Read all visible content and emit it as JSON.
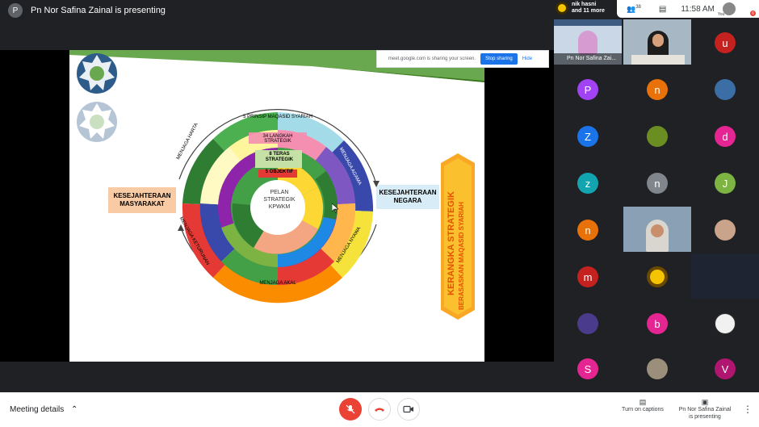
{
  "header": {
    "presenter_initial": "P",
    "presenting_title": "Pn Nor Safina Zainal is presenting"
  },
  "share_bar": {
    "message": "meet.google.com is sharing your screen.",
    "stop_label": "Stop sharing",
    "hide_label": "Hide"
  },
  "slide": {
    "left_box": "KESEJAHTERAAN MASYARAKAT",
    "right_box": "KESEJAHTERAAN NEGARA",
    "ribbon_main": "KERANGKA STRATEGIK",
    "ribbon_sub": "BERASASKAN MAQASID SYARIAH",
    "center_line1": "PELAN",
    "center_line2": "STRATEGIK",
    "center_line3": "KPWKM",
    "ring_outer": "5 PRINSIP MAQASID SYARIAH",
    "ring_langkah": "34 LANGKAH STRATEGIK",
    "ring_teras": "8 TERAS STRATEGIK",
    "ring_objektif": "5 OBJEKTIF",
    "seg_harta": "MENJAGA HARTA",
    "seg_agama": "MENJAGA AGAMA",
    "seg_nyawa": "MENJAGA NYAWA",
    "seg_akal": "MENJAGA AKAL",
    "seg_keturunan": "MENJAGA KETURUNAN"
  },
  "sidebar": {
    "top_name_line1": "nik hasni",
    "top_name_line2": "and 11 more",
    "people_count": "38",
    "time": "11:58 AM",
    "you_label": "You",
    "badge": "6",
    "presenter_tile_label": "Pn Nor Safina Zai...",
    "participants": [
      {
        "initial": "u",
        "color": "#c5221f"
      },
      {
        "initial": "P",
        "color": "#a142f4"
      },
      {
        "initial": "n",
        "color": "#e8710a"
      },
      {
        "initial": "Z",
        "color": "#1a73e8"
      },
      {
        "initial": "d",
        "color": "#e52592"
      },
      {
        "initial": "z",
        "color": "#12a4af"
      },
      {
        "initial": "n",
        "color": "#80868b"
      },
      {
        "initial": "J",
        "color": "#7cb342"
      },
      {
        "initial": "n",
        "color": "#e8710a"
      },
      {
        "initial": "m",
        "color": "#c5221f"
      },
      {
        "initial": "b",
        "color": "#e52592"
      },
      {
        "initial": "S",
        "color": "#e52592"
      },
      {
        "initial": "V",
        "color": "#b0166f"
      }
    ]
  },
  "bottombar": {
    "meeting_details": "Meeting details",
    "captions_label": "Turn on captions",
    "presenting_label_1": "Pn Nor Safina Zainal",
    "presenting_label_2": "is presenting"
  }
}
